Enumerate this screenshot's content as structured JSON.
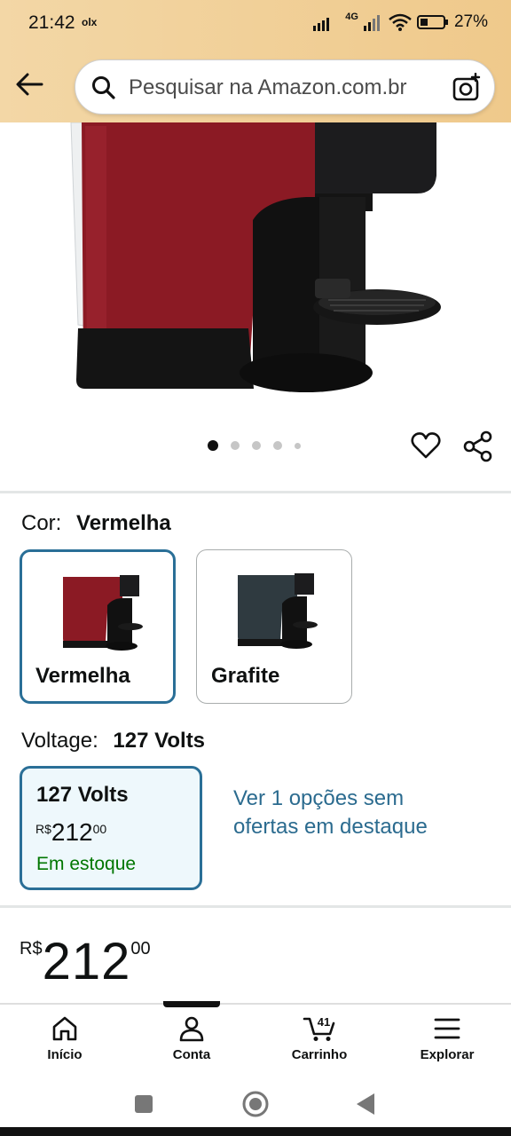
{
  "status_bar": {
    "time": "21:42",
    "notification": "olx",
    "network": "4G",
    "battery_percent": "27%"
  },
  "header": {
    "search_placeholder": "Pesquisar na Amazon.com.br",
    "back_icon": "arrow-left-icon",
    "camera_icon": "camera-icon"
  },
  "gallery": {
    "image_count": 5,
    "active_index": 0
  },
  "color": {
    "label": "Cor:",
    "selected": "Vermelha",
    "options": [
      {
        "name": "Vermelha",
        "swatch_color": "#8b1a24",
        "selected": true
      },
      {
        "name": "Grafite",
        "swatch_color": "#2f3a40",
        "selected": false
      }
    ]
  },
  "voltage": {
    "label": "Voltage:",
    "selected": "127 Volts",
    "option": {
      "title": "127 Volts",
      "currency": "R$",
      "price_whole": "212",
      "price_cents": "00",
      "stock": "Em estoque"
    },
    "more_options": "Ver 1 opções sem ofertas em destaque"
  },
  "price": {
    "currency": "R$",
    "whole": "212",
    "cents": "00"
  },
  "bottom_nav": {
    "items": [
      {
        "label": "Início",
        "icon": "home-icon"
      },
      {
        "label": "Conta",
        "icon": "account-icon"
      },
      {
        "label": "Carrinho",
        "icon": "cart-icon",
        "badge": "41"
      },
      {
        "label": "Explorar",
        "icon": "menu-icon"
      }
    ],
    "active_index": 1
  },
  "colors": {
    "accent_blue": "#2a6f97",
    "link_blue": "#2b6b8f",
    "in_stock_green": "#007600",
    "header_bg": "#efc98b"
  }
}
